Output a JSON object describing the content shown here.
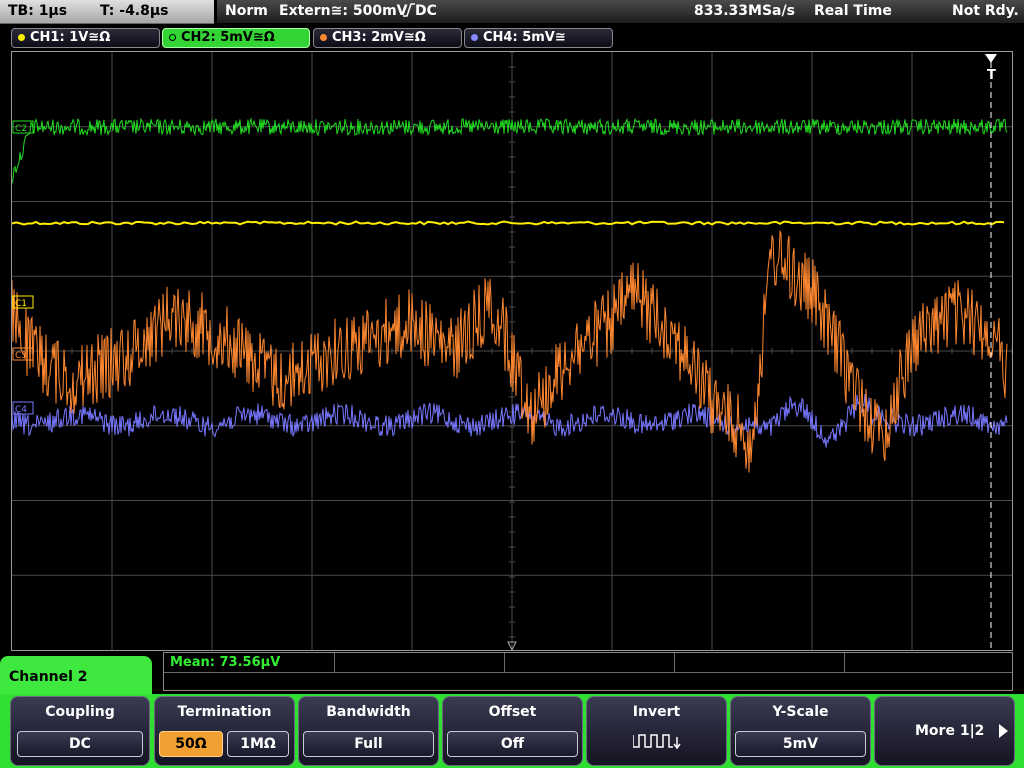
{
  "status": {
    "timebase": "TB: 1µs",
    "trigger_time": "T: -4.8µs",
    "trigger_mode": "Norm",
    "trigger_source": "Extern≅: 500mV",
    "trigger_coupling": "DC",
    "sample_rate": "833.33MSa/s",
    "acq_mode": "Real Time",
    "trigger_state": "Not Rdy."
  },
  "channels": [
    {
      "label": "CH1: 1V≅Ω",
      "color": "#ffee00"
    },
    {
      "label": "CH2: 5mV≅Ω",
      "color": "#22dd22"
    },
    {
      "label": "CH3: 2mV≅Ω",
      "color": "#ff8830"
    },
    {
      "label": "CH4: 5mV≅",
      "color": "#7777ff"
    }
  ],
  "markers": {
    "ch2": "C2",
    "ch1": "C1",
    "ch3": "C3",
    "ch4": "C4",
    "trigger": "T"
  },
  "measurement": {
    "mean": "Mean: 73.56µV"
  },
  "menu": {
    "title": "Channel 2",
    "coupling": {
      "label": "Coupling",
      "value": "DC"
    },
    "termination": {
      "label": "Termination",
      "options": [
        "50Ω",
        "1MΩ"
      ],
      "selected": "50Ω"
    },
    "bandwidth": {
      "label": "Bandwidth",
      "value": "Full"
    },
    "offset": {
      "label": "Offset",
      "value": "Off"
    },
    "invert": {
      "label": "Invert",
      "icon": "inverted-square-wave-icon"
    },
    "yscale": {
      "label": "Y-Scale",
      "value": "5mV"
    },
    "more": {
      "label": "More 1|2"
    }
  },
  "colors": {
    "accent_green": "#30e030",
    "grid": "#4a4a4a",
    "termination_selected": "#f0a030"
  }
}
